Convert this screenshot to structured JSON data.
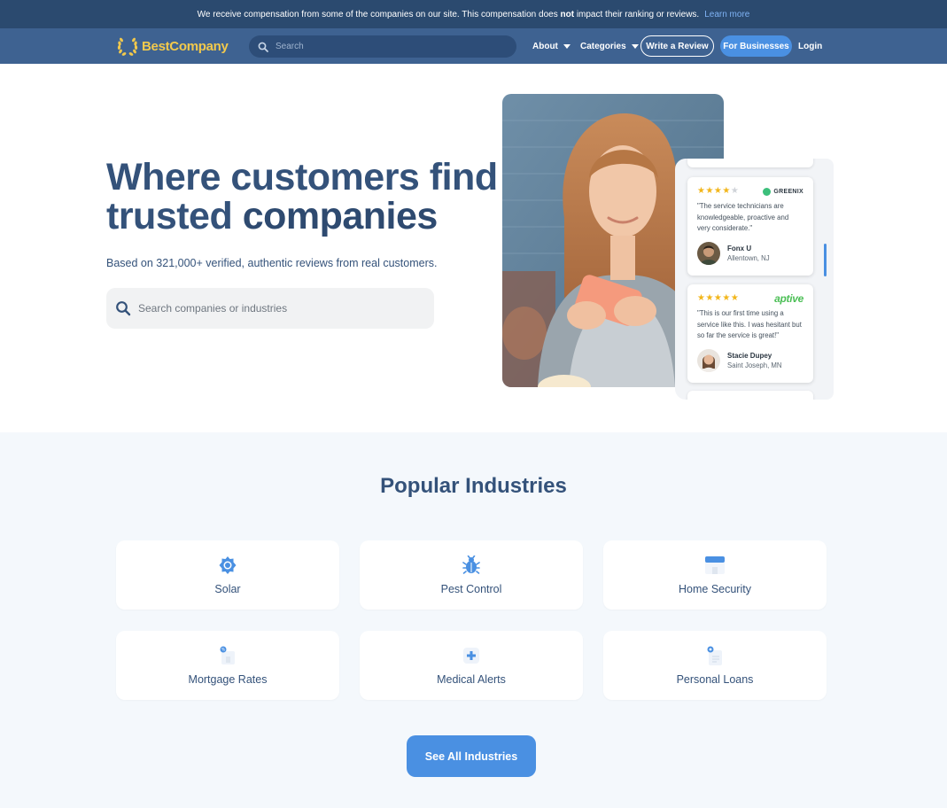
{
  "disclosure": {
    "text_before": "We receive compensation from some of the companies on our site. This compensation does",
    "text_bold": "not",
    "text_after": "impact their ranking or reviews.",
    "link": "Learn more"
  },
  "navbar": {
    "logo_text": "BestCompany",
    "search_placeholder": "Search",
    "about": "About",
    "categories": "Categories",
    "write_review": "Write a Review",
    "for_businesses": "For Businesses",
    "login": "Login"
  },
  "hero": {
    "title_line1": "Where customers find",
    "title_line2_regular": "trusted",
    "title_line2_bold": "companies",
    "subtitle": "Based on 321,000+ verified, authentic reviews from real customers.",
    "search_placeholder": "Search companies or industries"
  },
  "reviews": [
    {
      "rating": 4,
      "brand": "GREENIX",
      "quote": "\"The service technicians are knowledgeable, proactive and very considerate.\"",
      "name": "Fonx U",
      "location": "Allentown, NJ"
    },
    {
      "rating": 5,
      "brand": "aptive",
      "quote": "\"This is our first time using a service like this. I was hesitant but so far the service is great!\"",
      "name": "Stacie Dupey",
      "location": "Saint Joseph, MN"
    }
  ],
  "industries": {
    "title": "Popular Industries",
    "tiles": [
      {
        "label": "Solar",
        "icon": "sun-icon"
      },
      {
        "label": "Pest Control",
        "icon": "bug-icon"
      },
      {
        "label": "Home Security",
        "icon": "house-icon"
      },
      {
        "label": "Mortgage Rates",
        "icon": "mortgage-icon"
      },
      {
        "label": "Medical Alerts",
        "icon": "medical-plus-icon"
      },
      {
        "label": "Personal Loans",
        "icon": "loan-document-icon"
      }
    ],
    "see_all": "See All Industries"
  },
  "colors": {
    "navy": "#2b4a6f",
    "nav_bg": "#3e6291",
    "accent_blue": "#4a90e2",
    "logo_gold": "#f2c94c",
    "star_gold": "#f2b61b",
    "section_bg": "#f4f8fc"
  }
}
